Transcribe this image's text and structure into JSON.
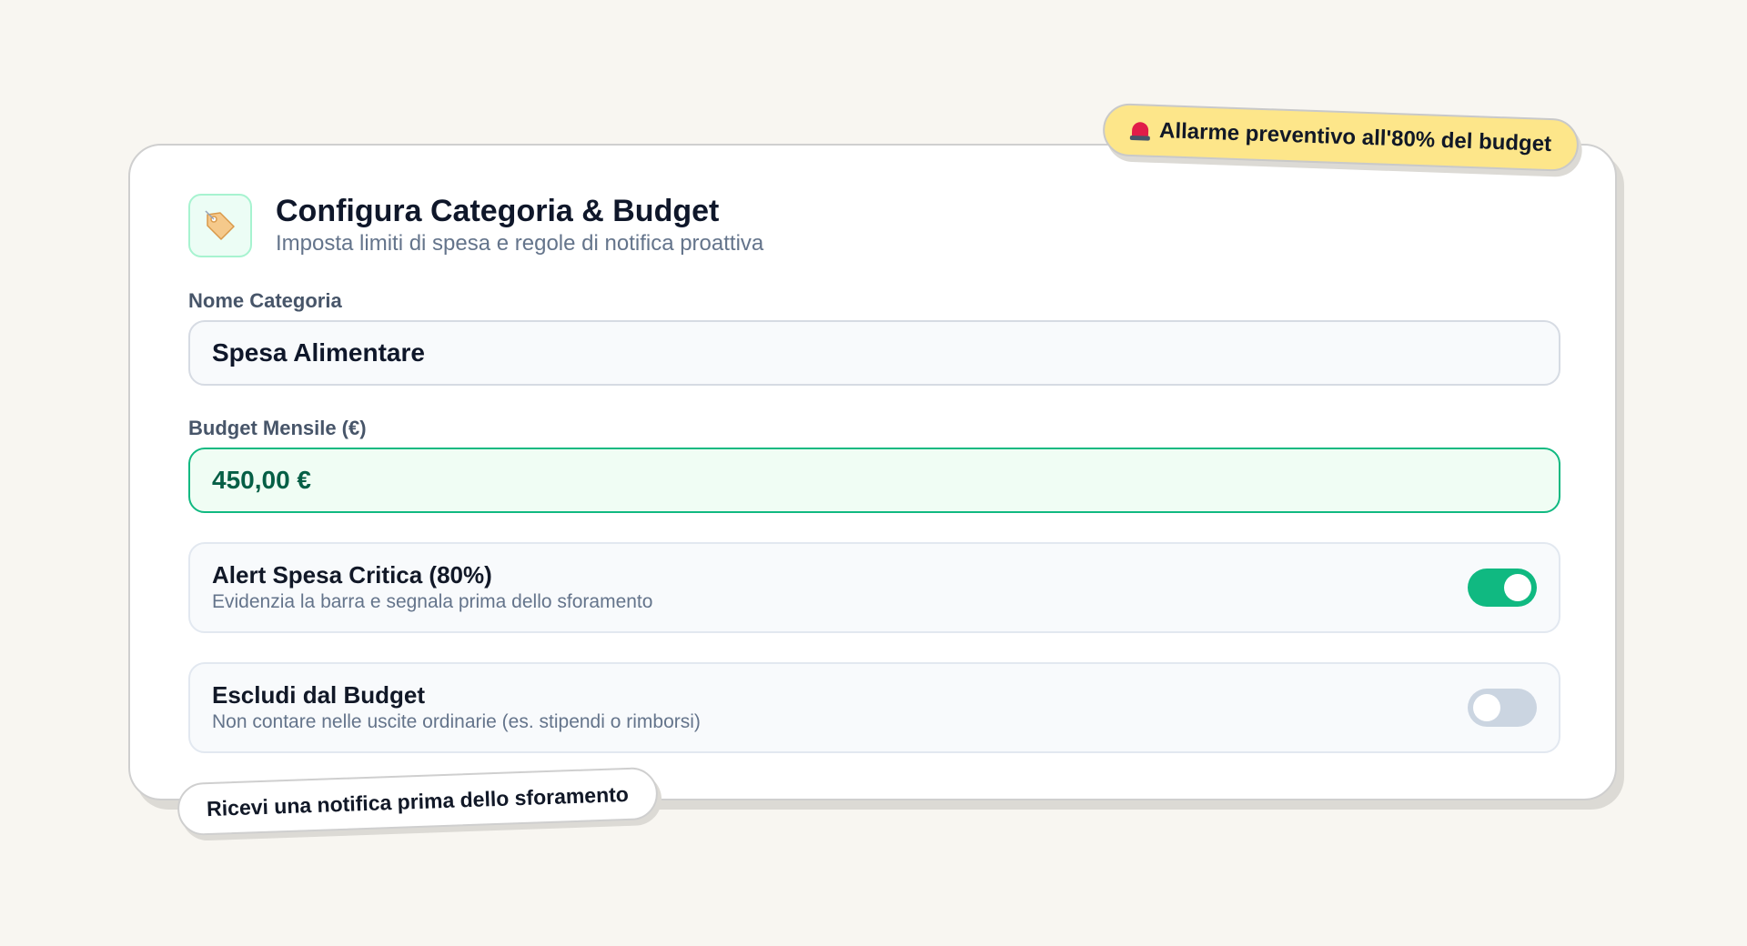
{
  "badges": {
    "top_icon": "siren-icon",
    "top_text": "Allarme preventivo all'80% del budget",
    "bottom_text": "Ricevi una notifica prima dello sforamento"
  },
  "header": {
    "icon": "tag-icon",
    "title": "Configura Categoria & Budget",
    "subtitle": "Imposta limiti di spesa e regole di notifica proattiva"
  },
  "form": {
    "name_label": "Nome Categoria",
    "name_value": "Spesa Alimentare",
    "budget_label": "Budget Mensile (€)",
    "budget_value": "450,00 €"
  },
  "toggles": [
    {
      "title": "Alert Spesa Critica (80%)",
      "description": "Evidenzia la barra e segnala prima dello sforamento",
      "enabled": true
    },
    {
      "title": "Escludi dal Budget",
      "description": "Non contare nelle uscite ordinarie (es. stipendi o rimborsi)",
      "enabled": false
    }
  ],
  "colors": {
    "accent": "#10b981",
    "badge_yellow": "#fde68a",
    "background": "#f8f6f1"
  }
}
